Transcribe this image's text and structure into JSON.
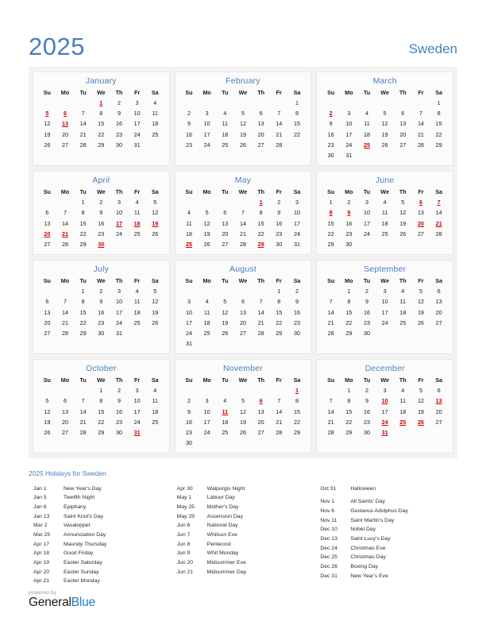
{
  "header": {
    "year": "2025",
    "country": "Sweden",
    "accent_color": "#4a7ebb",
    "holiday_color": "#d00000"
  },
  "weekday_headers": [
    "Su",
    "Mo",
    "Tu",
    "We",
    "Th",
    "Fr",
    "Sa"
  ],
  "months": [
    {
      "name": "January",
      "lead_blank": 3,
      "days": 31,
      "holidays": [
        1,
        5,
        6,
        13
      ]
    },
    {
      "name": "February",
      "lead_blank": 6,
      "days": 28,
      "holidays": []
    },
    {
      "name": "March",
      "lead_blank": 6,
      "days": 31,
      "holidays": [
        2,
        25
      ]
    },
    {
      "name": "April",
      "lead_blank": 2,
      "days": 30,
      "holidays": [
        17,
        18,
        19,
        20,
        21,
        30
      ]
    },
    {
      "name": "May",
      "lead_blank": 4,
      "days": 31,
      "holidays": [
        1,
        25,
        29
      ]
    },
    {
      "name": "June",
      "lead_blank": 0,
      "days": 30,
      "holidays": [
        6,
        7,
        8,
        9,
        20,
        21
      ]
    },
    {
      "name": "July",
      "lead_blank": 2,
      "days": 31,
      "holidays": []
    },
    {
      "name": "August",
      "lead_blank": 5,
      "days": 31,
      "holidays": []
    },
    {
      "name": "September",
      "lead_blank": 1,
      "days": 30,
      "holidays": []
    },
    {
      "name": "October",
      "lead_blank": 3,
      "days": 31,
      "holidays": [
        31
      ]
    },
    {
      "name": "November",
      "lead_blank": 6,
      "days": 30,
      "holidays": [
        1,
        6,
        11
      ]
    },
    {
      "name": "December",
      "lead_blank": 1,
      "days": 31,
      "holidays": [
        10,
        13,
        24,
        25,
        26,
        31
      ]
    }
  ],
  "holidays_section": {
    "title": "2025 Holidays for Sweden",
    "columns": [
      [
        {
          "date": "Jan 1",
          "name": "New Year's Day"
        },
        {
          "date": "Jan 5",
          "name": "Twelfth Night"
        },
        {
          "date": "Jan 6",
          "name": "Epiphany"
        },
        {
          "date": "Jan 13",
          "name": "Saint Knut's Day"
        },
        {
          "date": "Mar 2",
          "name": "Vasaloppet"
        },
        {
          "date": "Mar 25",
          "name": "Annunciation Day"
        },
        {
          "date": "Apr 17",
          "name": "Maundy Thursday"
        },
        {
          "date": "Apr 18",
          "name": "Good Friday"
        },
        {
          "date": "Apr 19",
          "name": "Easter Saturday"
        },
        {
          "date": "Apr 20",
          "name": "Easter Sunday"
        },
        {
          "date": "Apr 21",
          "name": "Easter Monday"
        }
      ],
      [
        {
          "date": "Apr 30",
          "name": "Walpurgis Night"
        },
        {
          "date": "May 1",
          "name": "Labour Day"
        },
        {
          "date": "May 25",
          "name": "Mother's Day"
        },
        {
          "date": "May 29",
          "name": "Ascension Day"
        },
        {
          "date": "Jun 6",
          "name": "National Day"
        },
        {
          "date": "Jun 7",
          "name": "Whitsun Eve"
        },
        {
          "date": "Jun 8",
          "name": "Pentecost"
        },
        {
          "date": "Jun 9",
          "name": "Whit Monday"
        },
        {
          "date": "Jun 20",
          "name": "Midsummer Eve"
        },
        {
          "date": "Jun 21",
          "name": "Midsummer Day"
        }
      ],
      [
        {
          "date": "Oct 31",
          "name": "Halloween"
        },
        {
          "date": "",
          "name": ""
        },
        {
          "date": "Nov 1",
          "name": "All Saints' Day"
        },
        {
          "date": "Nov 6",
          "name": "Gustavus Adolphus Day"
        },
        {
          "date": "Nov 11",
          "name": "Saint Martin's Day"
        },
        {
          "date": "Dec 10",
          "name": "Nobel Day"
        },
        {
          "date": "Dec 13",
          "name": "Saint Lucy's Day"
        },
        {
          "date": "Dec 24",
          "name": "Christmas Eve"
        },
        {
          "date": "Dec 25",
          "name": "Christmas Day"
        },
        {
          "date": "Dec 26",
          "name": "Boxing Day"
        },
        {
          "date": "Dec 31",
          "name": "New Year's Eve"
        }
      ]
    ]
  },
  "footer": {
    "powered_by": "powered by",
    "brand_first": "General",
    "brand_second": "Blue"
  }
}
